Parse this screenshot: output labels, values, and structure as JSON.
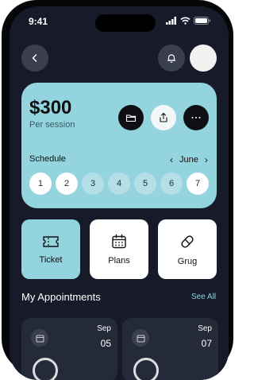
{
  "status_bar": {
    "time": "9:41"
  },
  "header": {
    "back_icon": "chevron-left-icon",
    "notification_icon": "bell-icon"
  },
  "session_card": {
    "price": "$300",
    "price_sub": "Per session",
    "actions": [
      "folder-icon",
      "share-icon",
      "more-icon"
    ],
    "schedule_label": "Schedule",
    "month": "June",
    "days": [
      {
        "label": "1",
        "active": true
      },
      {
        "label": "2",
        "active": true
      },
      {
        "label": "3",
        "active": false
      },
      {
        "label": "4",
        "active": false
      },
      {
        "label": "5",
        "active": false
      },
      {
        "label": "6",
        "active": false
      },
      {
        "label": "7",
        "active": true
      }
    ]
  },
  "tiles": [
    {
      "label": "Ticket",
      "icon": "ticket-icon"
    },
    {
      "label": "Plans",
      "icon": "calendar-icon"
    },
    {
      "label": "Grug",
      "icon": "pill-icon"
    }
  ],
  "appointments": {
    "title": "My Appointments",
    "see_all": "See All",
    "items": [
      {
        "month": "Sep",
        "day": "05"
      },
      {
        "month": "Sep",
        "day": "07"
      }
    ]
  },
  "colors": {
    "background": "#171b29",
    "card": "#94d4df",
    "accent": "#8fd3e1",
    "tile_active": "#94d4df",
    "tile": "#ffffff"
  }
}
